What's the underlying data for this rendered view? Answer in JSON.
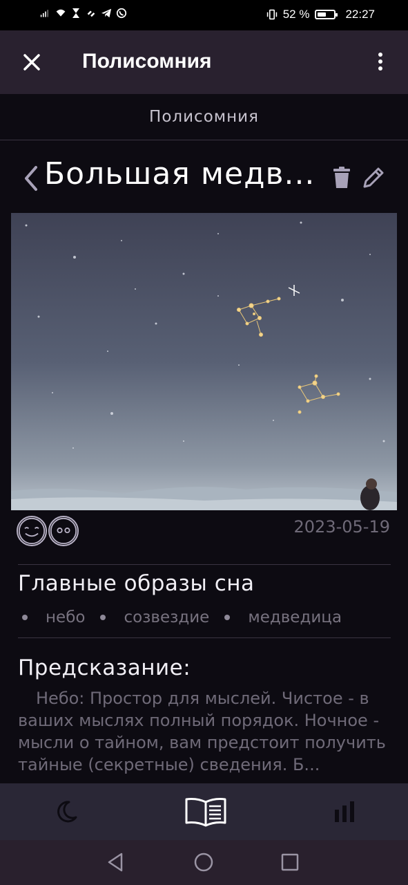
{
  "status_bar": {
    "battery": "52 %",
    "battery_level": 0.52,
    "time": "22:27"
  },
  "app_bar": {
    "title": "Полисомния"
  },
  "subheader": {
    "title": "Полисомния"
  },
  "dream": {
    "title": "Большая медв...",
    "date": "2023-05-19",
    "emotions": [
      "smiling-face-icon",
      "neutral-face-icon"
    ]
  },
  "images_section": {
    "title": "Главные образы сна",
    "tags": [
      "небо",
      "созвездие",
      "медведица"
    ]
  },
  "prediction": {
    "title": "Предсказание:",
    "text": "Небо: Простор для мыслей. Чистое - в ваших мыслях полный порядок. Ночное - мысли о тайном, вам предстоит получить тайные (секретные) сведения. Б..."
  },
  "bottom_nav": {
    "items": [
      "moon-icon",
      "book-icon",
      "stats-icon"
    ],
    "active": "book-icon"
  },
  "colors": {
    "app_bar": "#29212f",
    "background": "#0d0b12",
    "bottom_nav": "#2a2736",
    "accent_icon": "#b8b2c6"
  }
}
